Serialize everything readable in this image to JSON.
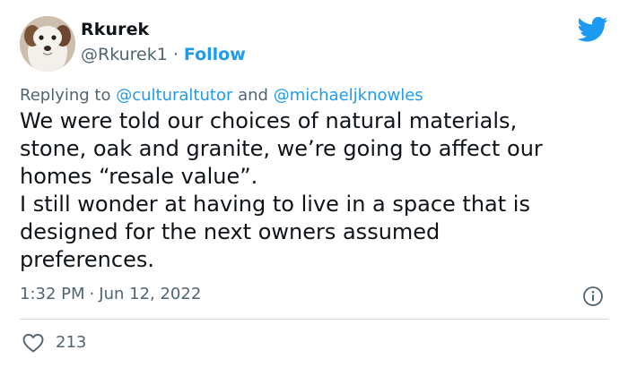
{
  "author": {
    "name": "Rkurek",
    "handle": "@Rkurek1",
    "separator": "·",
    "follow_label": "Follow",
    "avatar_icon": "dog-avatar"
  },
  "brand": {
    "logo_icon": "twitter-bird-icon",
    "color": "#1d9bf0"
  },
  "reply": {
    "prefix": "Replying to",
    "mention_1": "@culturaltutor",
    "conjunction": "and",
    "mention_2": "@michaeljknowles"
  },
  "tweet": {
    "lines": [
      "We were told our choices of natural materials,",
      "stone, oak and granite, we’re going to affect our",
      "homes “resale value”.",
      "I still wonder at having to live in a space that is",
      "designed for the next owners assumed",
      "preferences."
    ]
  },
  "meta": {
    "time": "1:32 PM",
    "separator": "·",
    "date": "Jun 12, 2022",
    "info_icon": "info-icon"
  },
  "engagement": {
    "like_icon": "heart-icon",
    "likes": "213"
  },
  "colors": {
    "text": "#0f1419",
    "secondary": "#536471",
    "link": "#1d9bf0",
    "divider": "#cfd9de"
  }
}
